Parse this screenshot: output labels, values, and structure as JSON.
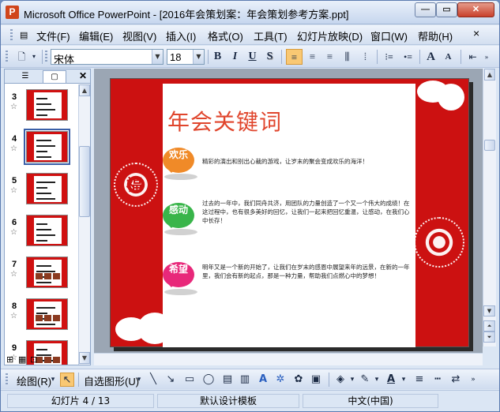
{
  "window": {
    "title": "Microsoft Office PowerPoint - [2016年会策划案：年会策划参考方案.ppt]",
    "app_icon": "P"
  },
  "menu": {
    "items": [
      "文件(F)",
      "编辑(E)",
      "视图(V)",
      "插入(I)",
      "格式(O)",
      "工具(T)",
      "幻灯片放映(D)",
      "窗口(W)",
      "帮助(H)"
    ]
  },
  "toolbar": {
    "font_name": "宋体",
    "font_size": "18",
    "bold": "B",
    "italic": "I",
    "underline": "U",
    "shadow": "S",
    "grow_font": "A",
    "shrink_font": "A"
  },
  "thumbnails": {
    "numbers": [
      "3",
      "4",
      "5",
      "6",
      "7",
      "8",
      "9"
    ],
    "selected": "4",
    "star": "☆"
  },
  "slide": {
    "title": "年会关键词",
    "items": [
      {
        "label": "欢乐",
        "color": "#f08a28",
        "text": "精彩的演出和别出心裁的游戏，让岁末的聚会变成欢乐的海洋！"
      },
      {
        "label": "感动",
        "color": "#39b54a",
        "text": "过去的一年中，我们同舟共济，用团队的力量创造了一个又一个伟大的成绩！在这过程中，也有很多美好的回忆，让我们一起来把回忆重温，让感动，在我们心中长存！"
      },
      {
        "label": "希望",
        "color": "#e8287a",
        "text": "明年又是一个新的开始了，让我们在岁末的感恩中展望来年的远景，在新的一年里，我们会有新的起点，那是一种力量，帮助我们点燃心中的梦想！"
      }
    ],
    "papercut_text": "福",
    "bg_color": "#cc1111"
  },
  "drawing_toolbar": {
    "draw": "绘图(R)",
    "autoshapes": "自选图形(U)"
  },
  "status": {
    "slide_pos": "幻灯片 4 / 13",
    "template": "默认设计模板",
    "language": "中文(中国)"
  }
}
